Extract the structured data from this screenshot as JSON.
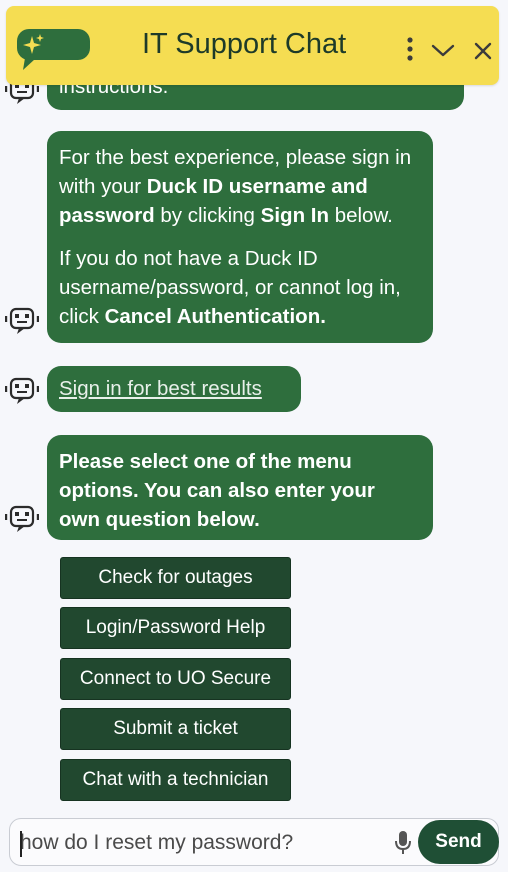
{
  "header": {
    "title": "IT Support Chat",
    "colors": {
      "bar": "#f5dd52",
      "logo": "#2e6e3d"
    },
    "icons": [
      "sparkle-chat-logo-icon",
      "kebab-menu-icon",
      "chevron-down-icon",
      "close-icon"
    ]
  },
  "messages": {
    "previous_fragment": "instructions.",
    "signin_info": {
      "p1_a": "For the best experience, please sign in with your ",
      "p1_b": "Duck ID username and password",
      "p1_c": " by clicking ",
      "p1_d": "Sign In",
      "p1_e": " below.",
      "p2_a": "If you do not have a Duck ID username/password, or cannot log in, click ",
      "p2_b": "Cancel Authentication."
    },
    "signin_link": "Sign in for best results",
    "menu_prompt": "Please select one of the menu options. You can also enter your own question below."
  },
  "menu": {
    "options": [
      "Check for outages",
      "Login/Password Help",
      "Connect to UO Secure",
      "Submit a ticket",
      "Chat with a technician"
    ]
  },
  "composer": {
    "placeholder": "how do I reset my password?",
    "send_label": "Send"
  },
  "colors": {
    "bubble": "#2e6e3d",
    "menu_button": "#21482f",
    "send_button": "#1f4f35"
  }
}
